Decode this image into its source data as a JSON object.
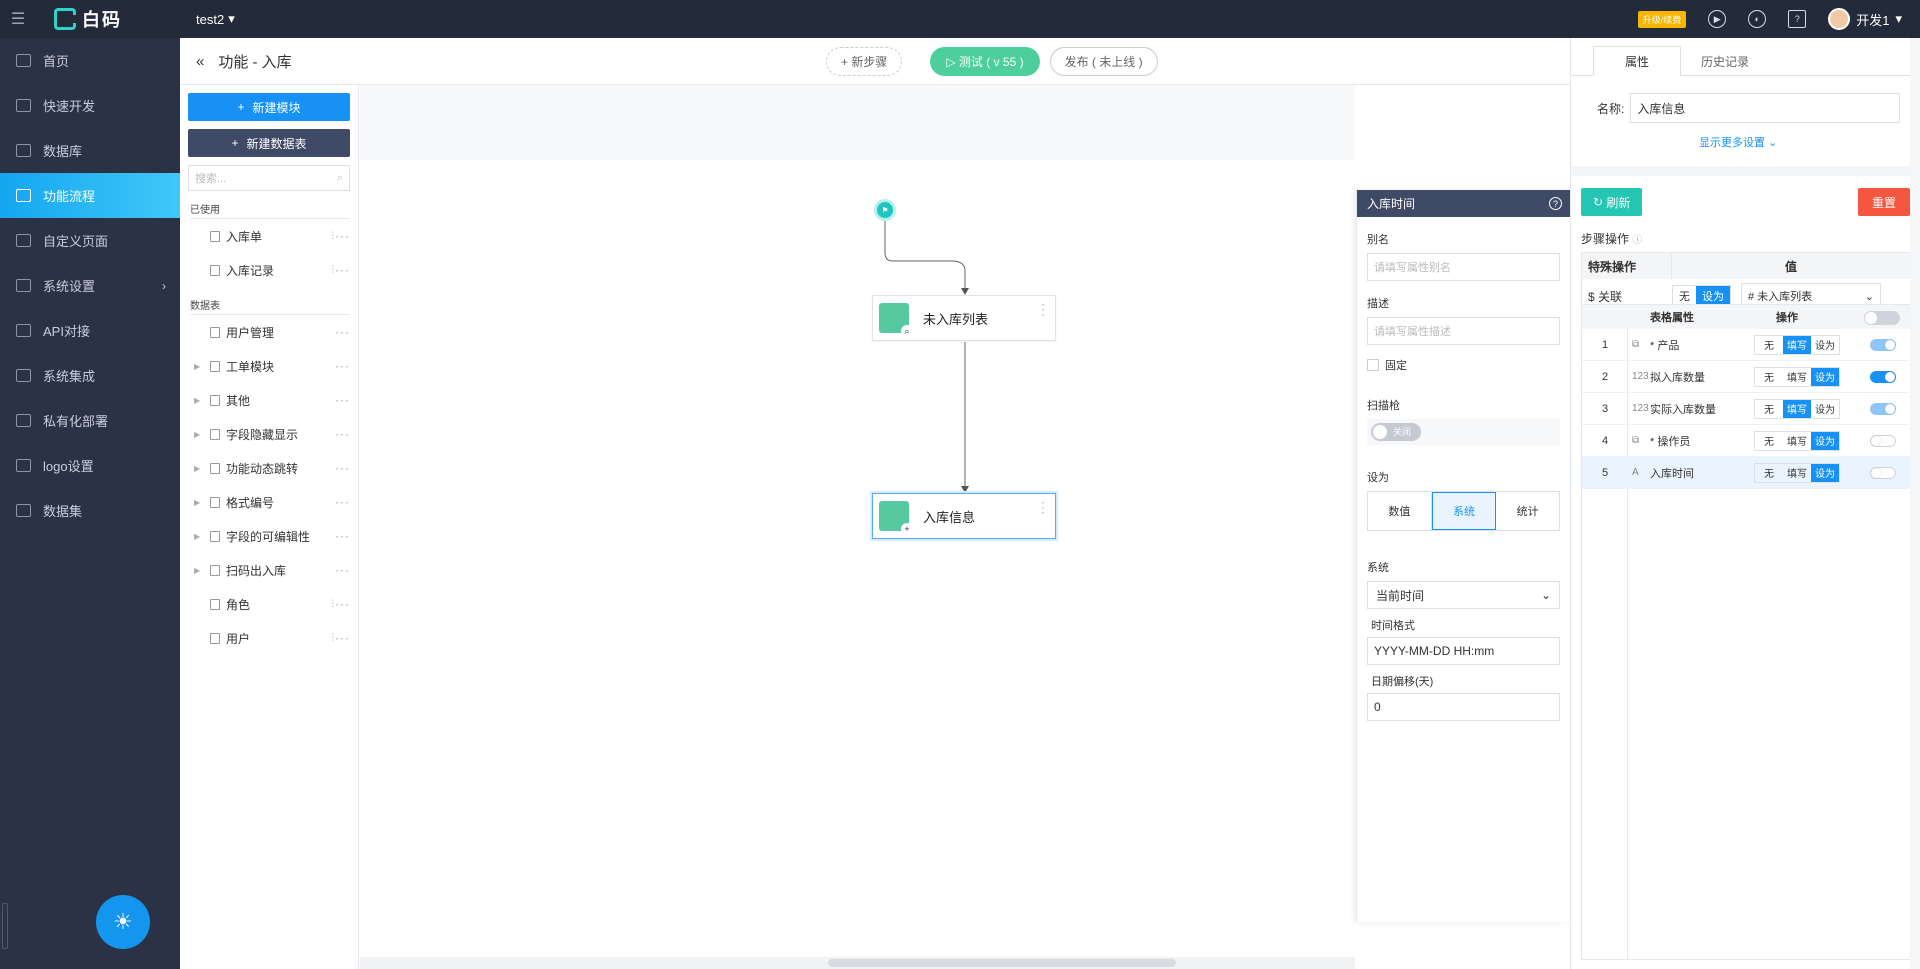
{
  "topbar": {
    "logo_text": "白码",
    "app_name": "test2",
    "upgrade_label": "升级/续费",
    "user_name": "开发1"
  },
  "sidebar": {
    "items": [
      {
        "label": "首页"
      },
      {
        "label": "快速开发"
      },
      {
        "label": "数据库"
      },
      {
        "label": "功能流程"
      },
      {
        "label": "自定义页面"
      },
      {
        "label": "系统设置"
      },
      {
        "label": "API对接"
      },
      {
        "label": "系统集成"
      },
      {
        "label": "私有化部署"
      },
      {
        "label": "logo设置"
      },
      {
        "label": "数据集"
      }
    ],
    "active_index": 3
  },
  "header": {
    "title": "功能 - 入库",
    "new_step_label": "+ 新步骤",
    "test_label": "▷ 测试 ( v 55 )",
    "publish_label": "发布 ( 未上线 )"
  },
  "left_panel": {
    "new_module_label": "新建模块",
    "new_table_label": "新建数据表",
    "search_placeholder": "搜索...",
    "used_label": "已使用",
    "used_items": [
      {
        "label": "入库单"
      },
      {
        "label": "入库记录"
      }
    ],
    "tables_label": "数据表",
    "table_items": [
      {
        "label": "用户管理"
      },
      {
        "label": "工单模块"
      },
      {
        "label": "其他"
      },
      {
        "label": "字段隐藏显示"
      },
      {
        "label": "功能动态跳转"
      },
      {
        "label": "格式编号"
      },
      {
        "label": "字段的可编辑性"
      },
      {
        "label": "扫码出入库"
      },
      {
        "label": "角色"
      },
      {
        "label": "用户"
      }
    ]
  },
  "canvas": {
    "nodes": [
      {
        "label": "未入库列表"
      },
      {
        "label": "入库信息"
      }
    ]
  },
  "props_panel": {
    "title": "入库时间",
    "alias_label": "别名",
    "alias_placeholder": "请填写属性别名",
    "desc_label": "描述",
    "desc_placeholder": "请填写属性描述",
    "fixed_label": "固定",
    "scanner_label": "扫描枪",
    "scanner_switch": "关闭",
    "setas_label": "设为",
    "setas_options": [
      "数值",
      "系统",
      "统计"
    ],
    "setas_selected": "系统",
    "system_label": "系统",
    "system_value": "当前时间",
    "format_label": "时间格式",
    "format_value": "YYYY-MM-DD HH:mm",
    "offset_label": "日期偏移(天)",
    "offset_value": "0"
  },
  "right_panel": {
    "tab_props": "属性",
    "tab_history": "历史记录",
    "name_label": "名称:",
    "name_value": "入库信息",
    "more_settings": "显示更多设置",
    "refresh_label": "刷新",
    "reset_label": "重置",
    "step_op_label": "步骤操作",
    "special_op_header": "特殊操作",
    "value_header": "值",
    "relation_label": "$ 关联",
    "rel_none": "无",
    "rel_set": "设为",
    "rel_value": "# 未入库列表",
    "attr_header": "表格属性",
    "op_header": "操作",
    "op_none": "无",
    "op_fill": "填写",
    "op_set": "设为",
    "rows": [
      {
        "n": "1",
        "icon": "⧉",
        "label": "* 产品",
        "op": "填写",
        "toggle": "on"
      },
      {
        "n": "2",
        "icon": "123",
        "label": "拟入库数量",
        "op": "设为",
        "toggle": "onf"
      },
      {
        "n": "3",
        "icon": "123",
        "label": "实际入库数量",
        "op": "填写",
        "toggle": "on"
      },
      {
        "n": "4",
        "icon": "⧉",
        "label": "* 操作员",
        "op": "设为",
        "toggle": "off"
      },
      {
        "n": "5",
        "icon": "A",
        "label": "入库时间",
        "op": "设为",
        "toggle": "off"
      }
    ]
  }
}
